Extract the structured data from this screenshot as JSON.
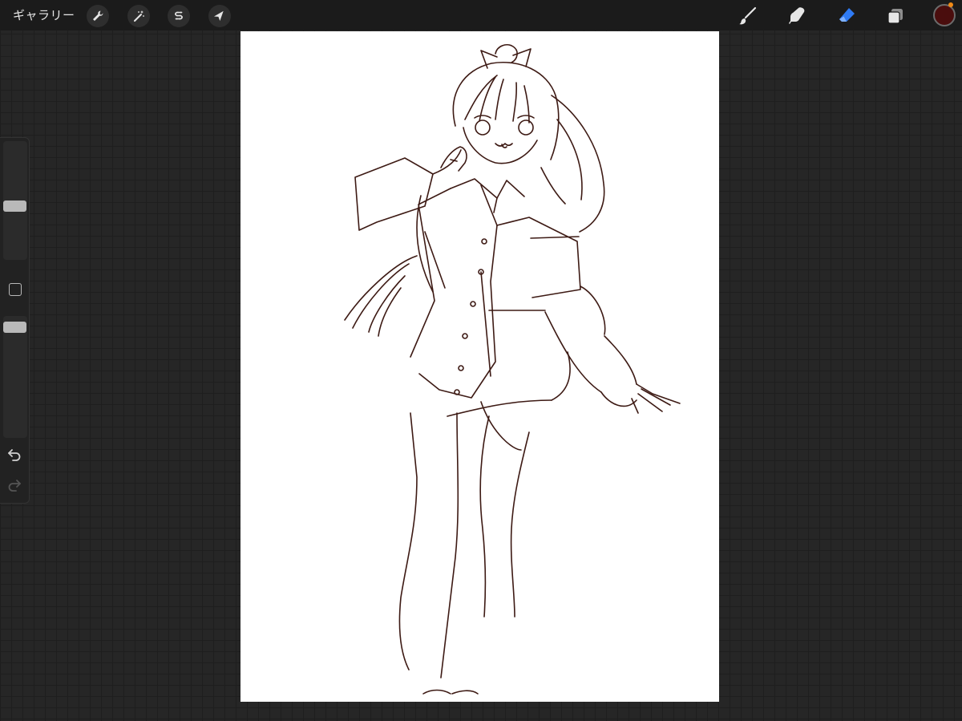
{
  "toolbar": {
    "gallery_label": "ギャラリー",
    "left_tools": [
      {
        "name": "actions",
        "icon": "wrench-icon"
      },
      {
        "name": "adjustments",
        "icon": "magic-wand-icon"
      },
      {
        "name": "selection",
        "icon": "selection-s-icon"
      },
      {
        "name": "transform",
        "icon": "arrow-cursor-icon"
      }
    ],
    "right_tools": [
      {
        "name": "brush",
        "icon": "brush-icon"
      },
      {
        "name": "smudge",
        "icon": "smudge-finger-icon"
      },
      {
        "name": "eraser",
        "icon": "eraser-icon",
        "active": true
      },
      {
        "name": "layers",
        "icon": "layers-icon"
      }
    ],
    "active_tool_color": "#2f7bf5",
    "current_color": "#4a0d0d"
  },
  "sidebar": {
    "brush_size_level": 0.45,
    "brush_opacity_level": 0.05,
    "undo_icon": "undo-arrow-icon",
    "redo_icon": "redo-arrow-icon",
    "modify_icon": "square-modify-icon"
  },
  "canvas": {
    "background": "#ffffff",
    "line_color": "#3d1a14",
    "drawing": "line-art-girl-sketch"
  }
}
